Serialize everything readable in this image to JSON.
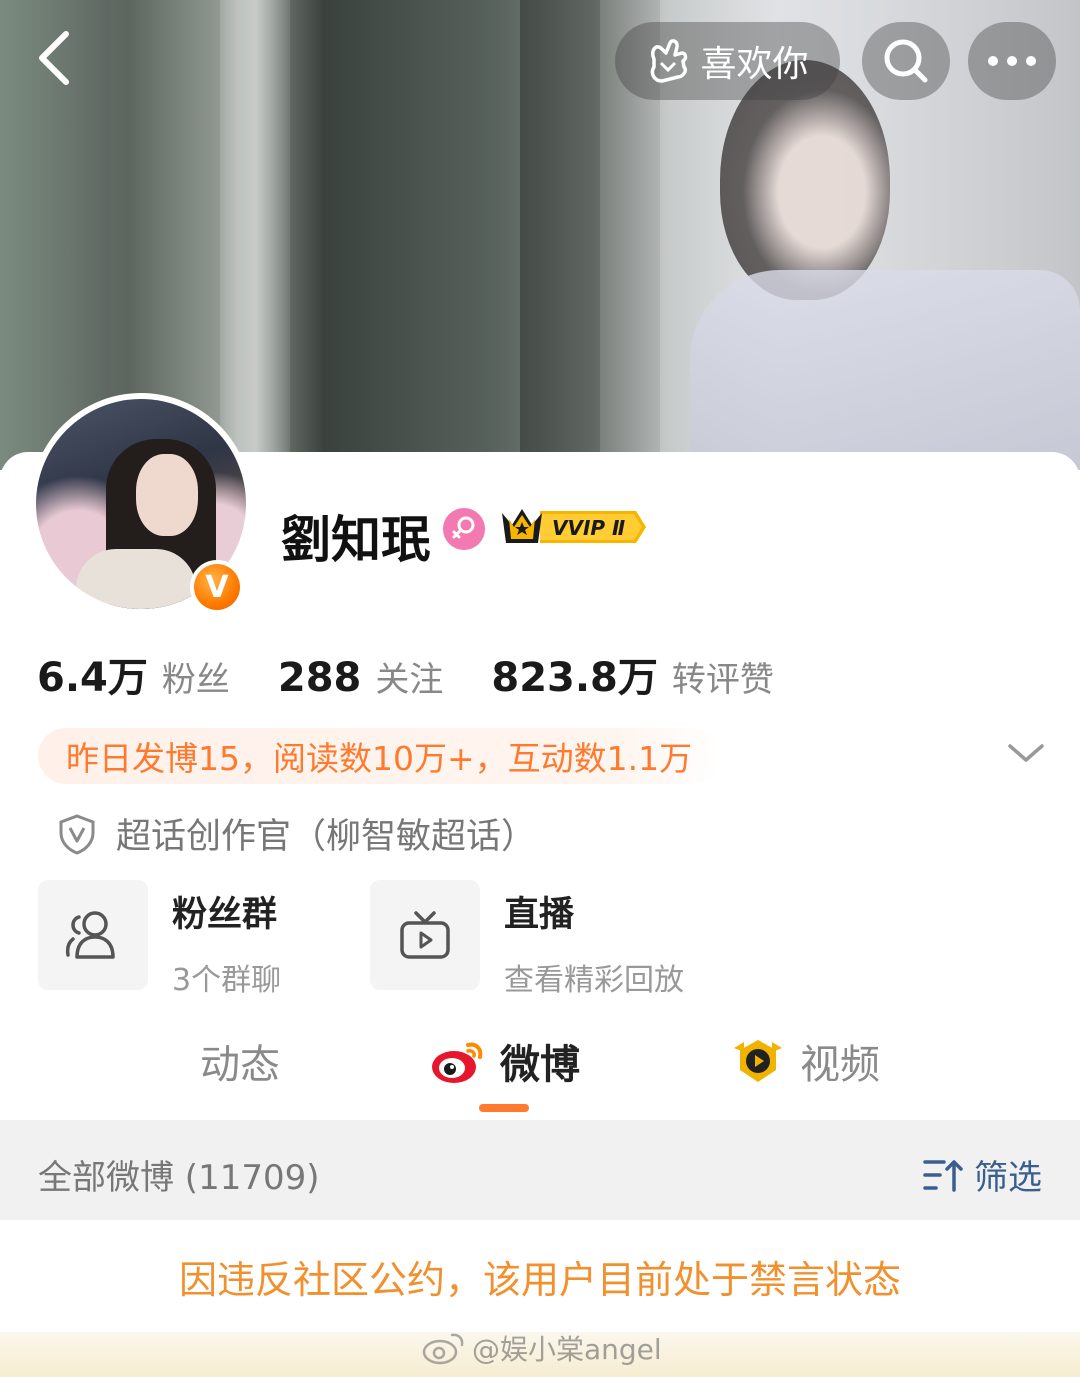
{
  "header": {
    "back_icon": "chevron-left-icon",
    "like_label": "喜欢你",
    "like_icon": "hand-heart-icon",
    "search_icon": "search-icon",
    "more_icon": "more-dots-icon"
  },
  "profile": {
    "name": "劉知珉",
    "gender_icon": "female-icon",
    "vip_badge": "VVIP Ⅱ",
    "verified_badge": "V",
    "accent": "#ff7a2e"
  },
  "stats": [
    {
      "value": "6.4万",
      "label": "粉丝"
    },
    {
      "value": "288",
      "label": "关注"
    },
    {
      "value": "823.8万",
      "label": "转评赞"
    }
  ],
  "daily_summary": "昨日发博15，阅读数10万+，互动数1.1万",
  "super_topic": "超话创作官（柳智敏超话）",
  "features": {
    "fans_group": {
      "title": "粉丝群",
      "subtitle": "3个群聊"
    },
    "live": {
      "title": "直播",
      "subtitle": "查看精彩回放"
    }
  },
  "tabs": [
    {
      "label": "动态"
    },
    {
      "label": "微博",
      "active": true
    },
    {
      "label": "视频"
    }
  ],
  "posts_bar": {
    "all_label": "全部微博 (11709)",
    "filter_label": "筛选"
  },
  "notice": "因违反社区公约，该用户目前处于禁言状态",
  "watermark": "@娱小棠angel"
}
